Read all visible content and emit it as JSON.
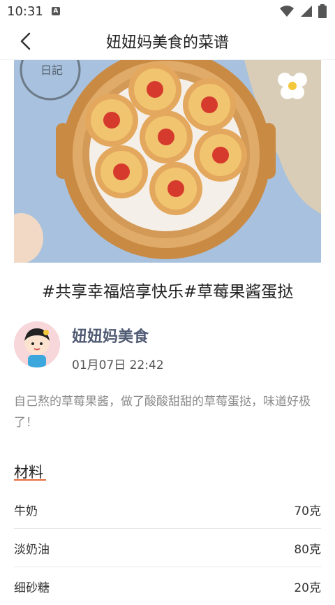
{
  "status_bar": {
    "time": "10:31",
    "notification_badge": "A"
  },
  "header": {
    "title": "妞妞妈美食的菜谱"
  },
  "hero": {
    "stamp_text": "日記"
  },
  "recipe": {
    "title": "#共享幸福焙享快乐#草莓果酱蛋挞",
    "author_name": "妞妞妈美食",
    "date": "01月07日 22:42",
    "description": "自己熬的草莓果酱，做了酸酸甜甜的草莓蛋挞，味道好极了！"
  },
  "ingredients": {
    "section_title": "材料",
    "items": [
      {
        "name": "牛奶",
        "amount": "70克"
      },
      {
        "name": "淡奶油",
        "amount": "80克"
      },
      {
        "name": "细砂糖",
        "amount": "20克"
      }
    ]
  },
  "colors": {
    "author_name": "#4f5a73",
    "accent_underline": "#e86a3a",
    "description": "#8a8a8a"
  }
}
